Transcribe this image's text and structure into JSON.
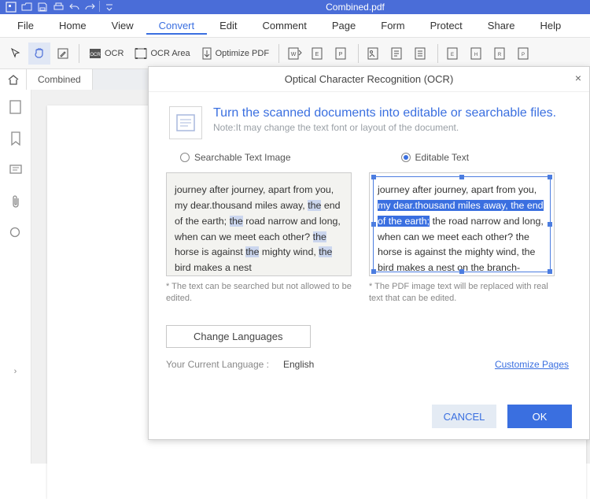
{
  "title": "Combined.pdf",
  "menu": {
    "file": "File",
    "home": "Home",
    "view": "View",
    "convert": "Convert",
    "edit": "Edit",
    "comment": "Comment",
    "page": "Page",
    "form": "Form",
    "protect": "Protect",
    "share": "Share",
    "help": "Help"
  },
  "toolbar": {
    "ocr": "OCR",
    "ocr_area": "OCR Area",
    "optimize": "Optimize PDF"
  },
  "tab": {
    "name": "Combined"
  },
  "dialog": {
    "title": "Optical Character Recognition (OCR)",
    "heading": "Turn the scanned documents into editable or searchable files.",
    "note": "Note:It may change the text font or layout of the document.",
    "opt_searchable": "Searchable Text Image",
    "opt_editable": "Editable Text",
    "preview_scan_text_1": "journey after journey, apart from you, my dear.thousand miles away, ",
    "preview_scan_hl_1": "the",
    "preview_scan_text_2": " end of the earth; ",
    "preview_scan_hl_2": "the",
    "preview_scan_text_3": " road narrow and long, when can we meet each other? ",
    "preview_scan_hl_3": "the",
    "preview_scan_text_4": " horse is against ",
    "preview_scan_hl_4": "the",
    "preview_scan_text_5": " mighty wind, ",
    "preview_scan_hl_5": "the",
    "preview_scan_text_6": " bird makes a nest",
    "preview_edit_text_1": "journey after journey, apart from you, ",
    "preview_edit_sel": "my dear.thousand miles away, the end of the earth;",
    "preview_edit_text_2": " the road narrow and long, when can we meet each other? the horse is against the mighty wind, the bird makes a nest on the branch-",
    "cap_scan": "* The text can be searched but not allowed to be edited.",
    "cap_edit": "* The PDF image text will be replaced with real text that can be edited.",
    "change_lang": "Change Languages",
    "current_lang_label": "Your Current Language :",
    "current_lang_value": "English",
    "customize": "Customize Pages",
    "cancel": "CANCEL",
    "ok": "OK"
  }
}
